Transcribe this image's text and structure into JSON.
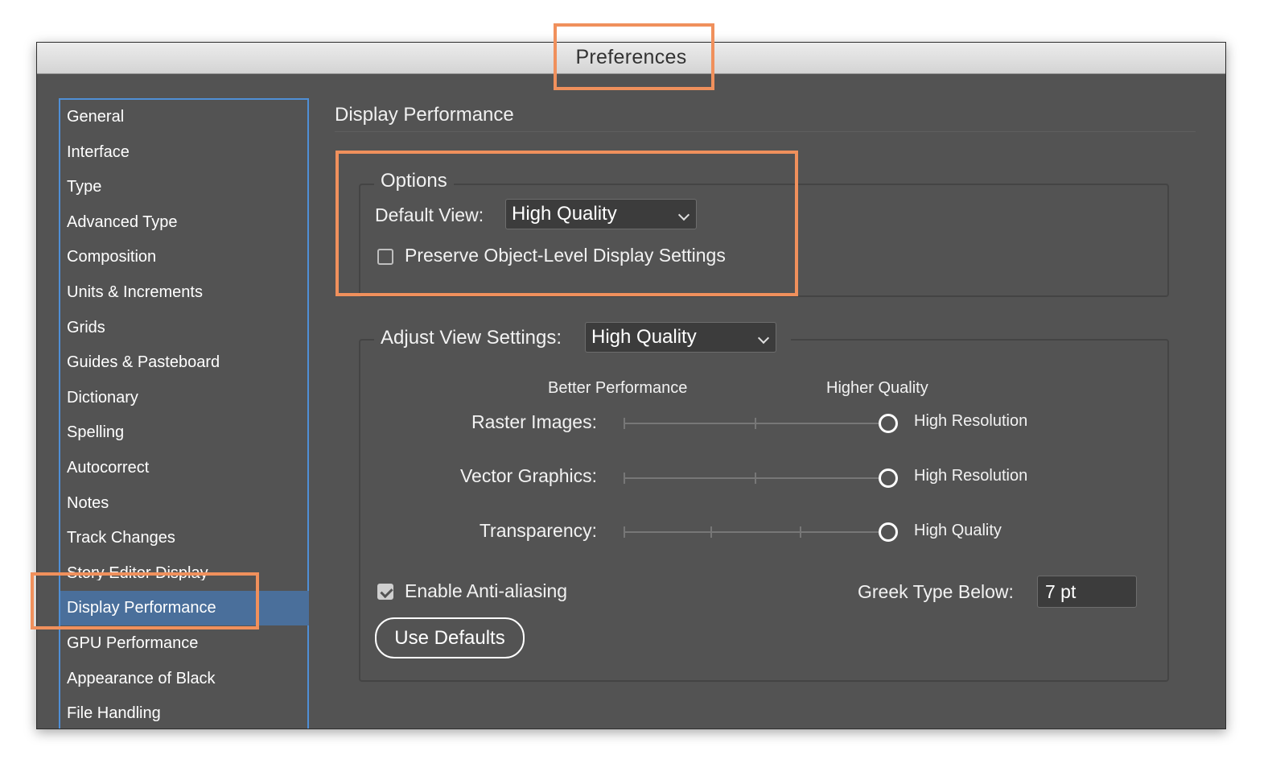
{
  "window": {
    "title": "Preferences"
  },
  "sidebar": {
    "items": [
      {
        "label": "General"
      },
      {
        "label": "Interface"
      },
      {
        "label": "Type"
      },
      {
        "label": "Advanced Type"
      },
      {
        "label": "Composition"
      },
      {
        "label": "Units & Increments"
      },
      {
        "label": "Grids"
      },
      {
        "label": "Guides & Pasteboard"
      },
      {
        "label": "Dictionary"
      },
      {
        "label": "Spelling"
      },
      {
        "label": "Autocorrect"
      },
      {
        "label": "Notes"
      },
      {
        "label": "Track Changes"
      },
      {
        "label": "Story Editor Display"
      },
      {
        "label": "Display Performance",
        "selected": true
      },
      {
        "label": "GPU Performance"
      },
      {
        "label": "Appearance of Black"
      },
      {
        "label": "File Handling"
      }
    ]
  },
  "panel": {
    "title": "Display Performance",
    "options": {
      "legend": "Options",
      "default_view_label": "Default View:",
      "default_view_value": "High Quality",
      "preserve_label": "Preserve Object-Level Display Settings",
      "preserve_checked": false
    },
    "adjust": {
      "legend_label": "Adjust View Settings:",
      "value": "High Quality",
      "left_heading": "Better Performance",
      "right_heading": "Higher Quality",
      "sliders": [
        {
          "label": "Raster Images:",
          "value_label": "High Resolution"
        },
        {
          "label": "Vector Graphics:",
          "value_label": "High Resolution"
        },
        {
          "label": "Transparency:",
          "value_label": "High Quality"
        }
      ],
      "antialias_label": "Enable Anti-aliasing",
      "antialias_checked": true,
      "greek_label": "Greek Type Below:",
      "greek_value": "7 pt",
      "defaults_button": "Use Defaults"
    }
  },
  "colors": {
    "highlight": "#f0905c",
    "selection": "#4a6f9b",
    "sidebar_border": "#4f8fd6"
  }
}
